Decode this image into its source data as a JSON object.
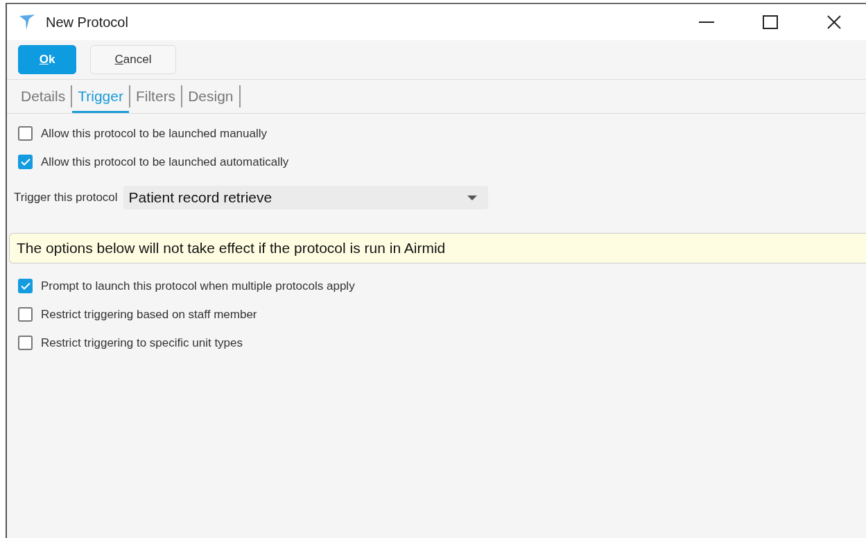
{
  "window": {
    "title": "New Protocol"
  },
  "buttons": [
    {
      "label": "Ok",
      "kind": "primary"
    },
    {
      "label": "Cancel",
      "kind": "secondary"
    }
  ],
  "tabs": [
    {
      "label": "Details",
      "selected": false
    },
    {
      "label": "Trigger",
      "selected": true
    },
    {
      "label": "Filters",
      "selected": false
    },
    {
      "label": "Design",
      "selected": false
    }
  ],
  "launch_options": [
    {
      "label": "Allow this protocol to be launched manually",
      "checked": false
    },
    {
      "label": "Allow this protocol to be launched automatically",
      "checked": true
    }
  ],
  "trigger": {
    "label": "Trigger this protocol",
    "value": "Patient record retrieve"
  },
  "notice": "The options below will not take effect if the protocol is run in Airmid",
  "options": [
    {
      "label": "Prompt to launch this protocol when multiple protocols apply",
      "checked": true
    },
    {
      "label": "Restrict triggering based on staff member",
      "checked": false
    },
    {
      "label": "Restrict triggering to specific unit types",
      "checked": false
    }
  ]
}
